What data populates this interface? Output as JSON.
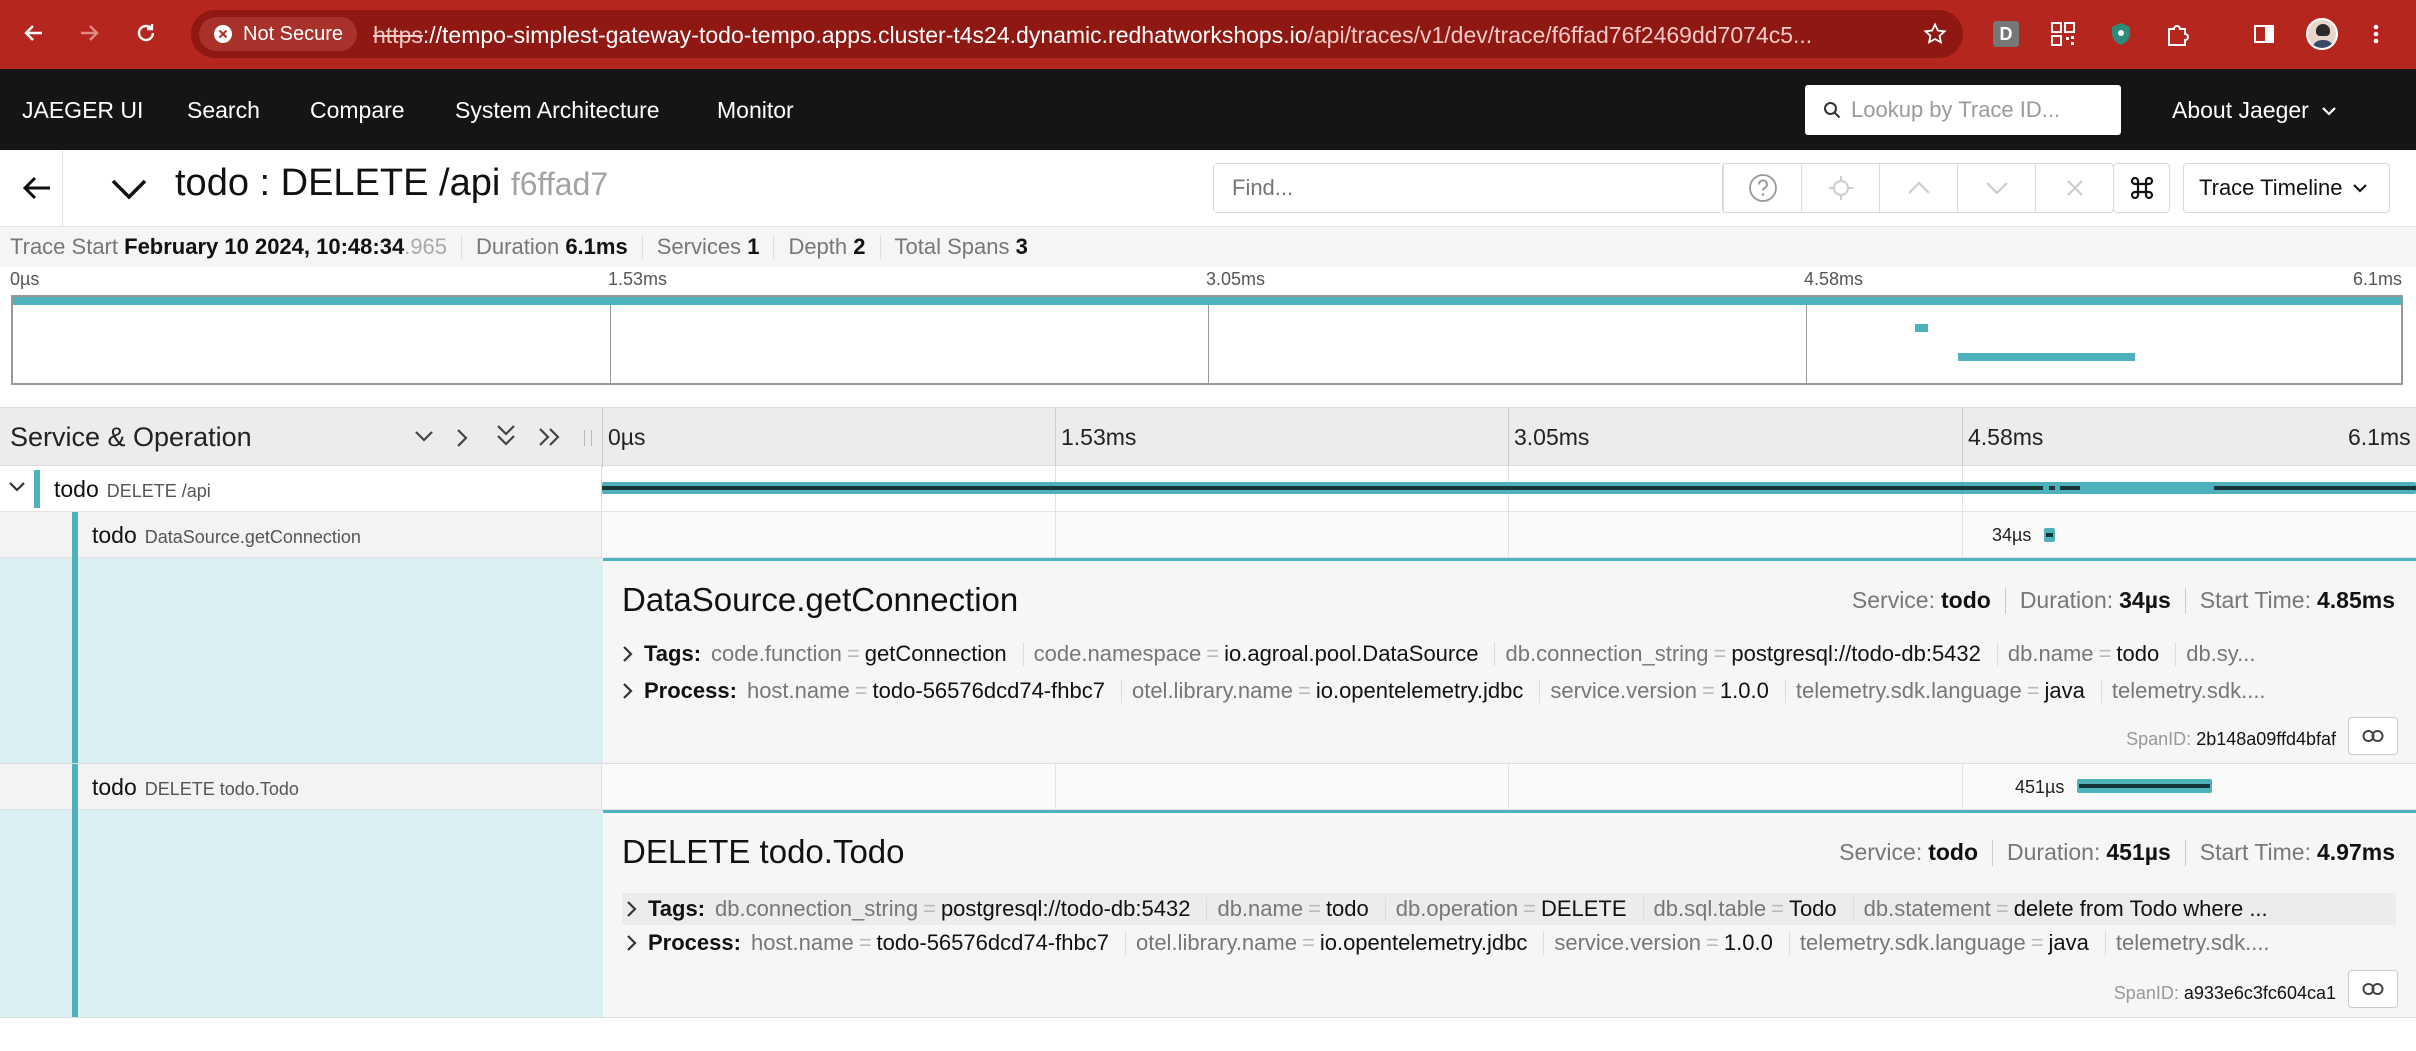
{
  "browser": {
    "security_label": "Not Secure",
    "url_scheme": "https",
    "url_host": "://tempo-simplest-gateway-todo-tempo.apps.cluster-t4s24.dynamic.redhatworkshops.io",
    "url_path": "/api/traces/v1/dev/trace/f6ffad76f2469dd7074c5...",
    "ext_d_label": "D"
  },
  "nav": {
    "brand": "JAEGER UI",
    "items": [
      "Search",
      "Compare",
      "System Architecture",
      "Monitor"
    ],
    "lookup_placeholder": "Lookup by Trace ID...",
    "about": "About Jaeger"
  },
  "trace": {
    "title": "todo : DELETE /api",
    "trace_id_short": "f6ffad7",
    "find_placeholder": "Find...",
    "view_mode": "Trace Timeline"
  },
  "meta": {
    "trace_start_label": "Trace Start",
    "trace_start_main": "February 10 2024, 10:48:34",
    "trace_start_ms": ".965",
    "duration_label": "Duration",
    "duration": "6.1ms",
    "services_label": "Services",
    "services": "1",
    "depth_label": "Depth",
    "depth": "2",
    "total_spans_label": "Total Spans",
    "total_spans": "3"
  },
  "ticks": [
    "0µs",
    "1.53ms",
    "3.05ms",
    "4.58ms",
    "6.1ms"
  ],
  "timeline_header": {
    "service_operation": "Service & Operation"
  },
  "spans": [
    {
      "service": "todo",
      "operation": "DELETE /api",
      "start_ms": 0,
      "duration_ms": 6.1
    },
    {
      "service": "todo",
      "operation": "DataSource.getConnection",
      "start_ms": 4.85,
      "duration_ms": 0.034,
      "duration_label": "34µs"
    },
    {
      "service": "todo",
      "operation": "DELETE todo.Todo",
      "start_ms": 4.97,
      "duration_ms": 0.451,
      "duration_label": "451µs"
    }
  ],
  "details": [
    {
      "title": "DataSource.getConnection",
      "service_label": "Service:",
      "service": "todo",
      "duration_label": "Duration:",
      "duration": "34µs",
      "start_label": "Start Time:",
      "start": "4.85ms",
      "tags_label": "Tags:",
      "tags": [
        {
          "k": "code.function",
          "v": "getConnection"
        },
        {
          "k": "code.namespace",
          "v": "io.agroal.pool.DataSource"
        },
        {
          "k": "db.connection_string",
          "v": "postgresql://todo-db:5432"
        },
        {
          "k": "db.name",
          "v": "todo"
        },
        {
          "k": "db.sy...",
          "v": ""
        }
      ],
      "process_label": "Process:",
      "process": [
        {
          "k": "host.name",
          "v": "todo-56576dcd74-fhbc7"
        },
        {
          "k": "otel.library.name",
          "v": "io.opentelemetry.jdbc"
        },
        {
          "k": "service.version",
          "v": "1.0.0"
        },
        {
          "k": "telemetry.sdk.language",
          "v": "java"
        },
        {
          "k": "telemetry.sdk....",
          "v": ""
        }
      ],
      "spanid_label": "SpanID:",
      "spanid": "2b148a09ffd4bfaf"
    },
    {
      "title": "DELETE todo.Todo",
      "service_label": "Service:",
      "service": "todo",
      "duration_label": "Duration:",
      "duration": "451µs",
      "start_label": "Start Time:",
      "start": "4.97ms",
      "tags_label": "Tags:",
      "tags": [
        {
          "k": "db.connection_string",
          "v": "postgresql://todo-db:5432"
        },
        {
          "k": "db.name",
          "v": "todo"
        },
        {
          "k": "db.operation",
          "v": "DELETE"
        },
        {
          "k": "db.sql.table",
          "v": "Todo"
        },
        {
          "k": "db.statement",
          "v": "delete from Todo where ..."
        }
      ],
      "process_label": "Process:",
      "process": [
        {
          "k": "host.name",
          "v": "todo-56576dcd74-fhbc7"
        },
        {
          "k": "otel.library.name",
          "v": "io.opentelemetry.jdbc"
        },
        {
          "k": "service.version",
          "v": "1.0.0"
        },
        {
          "k": "telemetry.sdk.language",
          "v": "java"
        },
        {
          "k": "telemetry.sdk....",
          "v": ""
        }
      ],
      "spanid_label": "SpanID:",
      "spanid": "a933e6c3fc604ca1"
    }
  ],
  "colors": {
    "chrome": "#b5261e",
    "nav": "#151515",
    "span_bar": "#4fb1bb",
    "detail_bg": "#dcf0f3"
  }
}
